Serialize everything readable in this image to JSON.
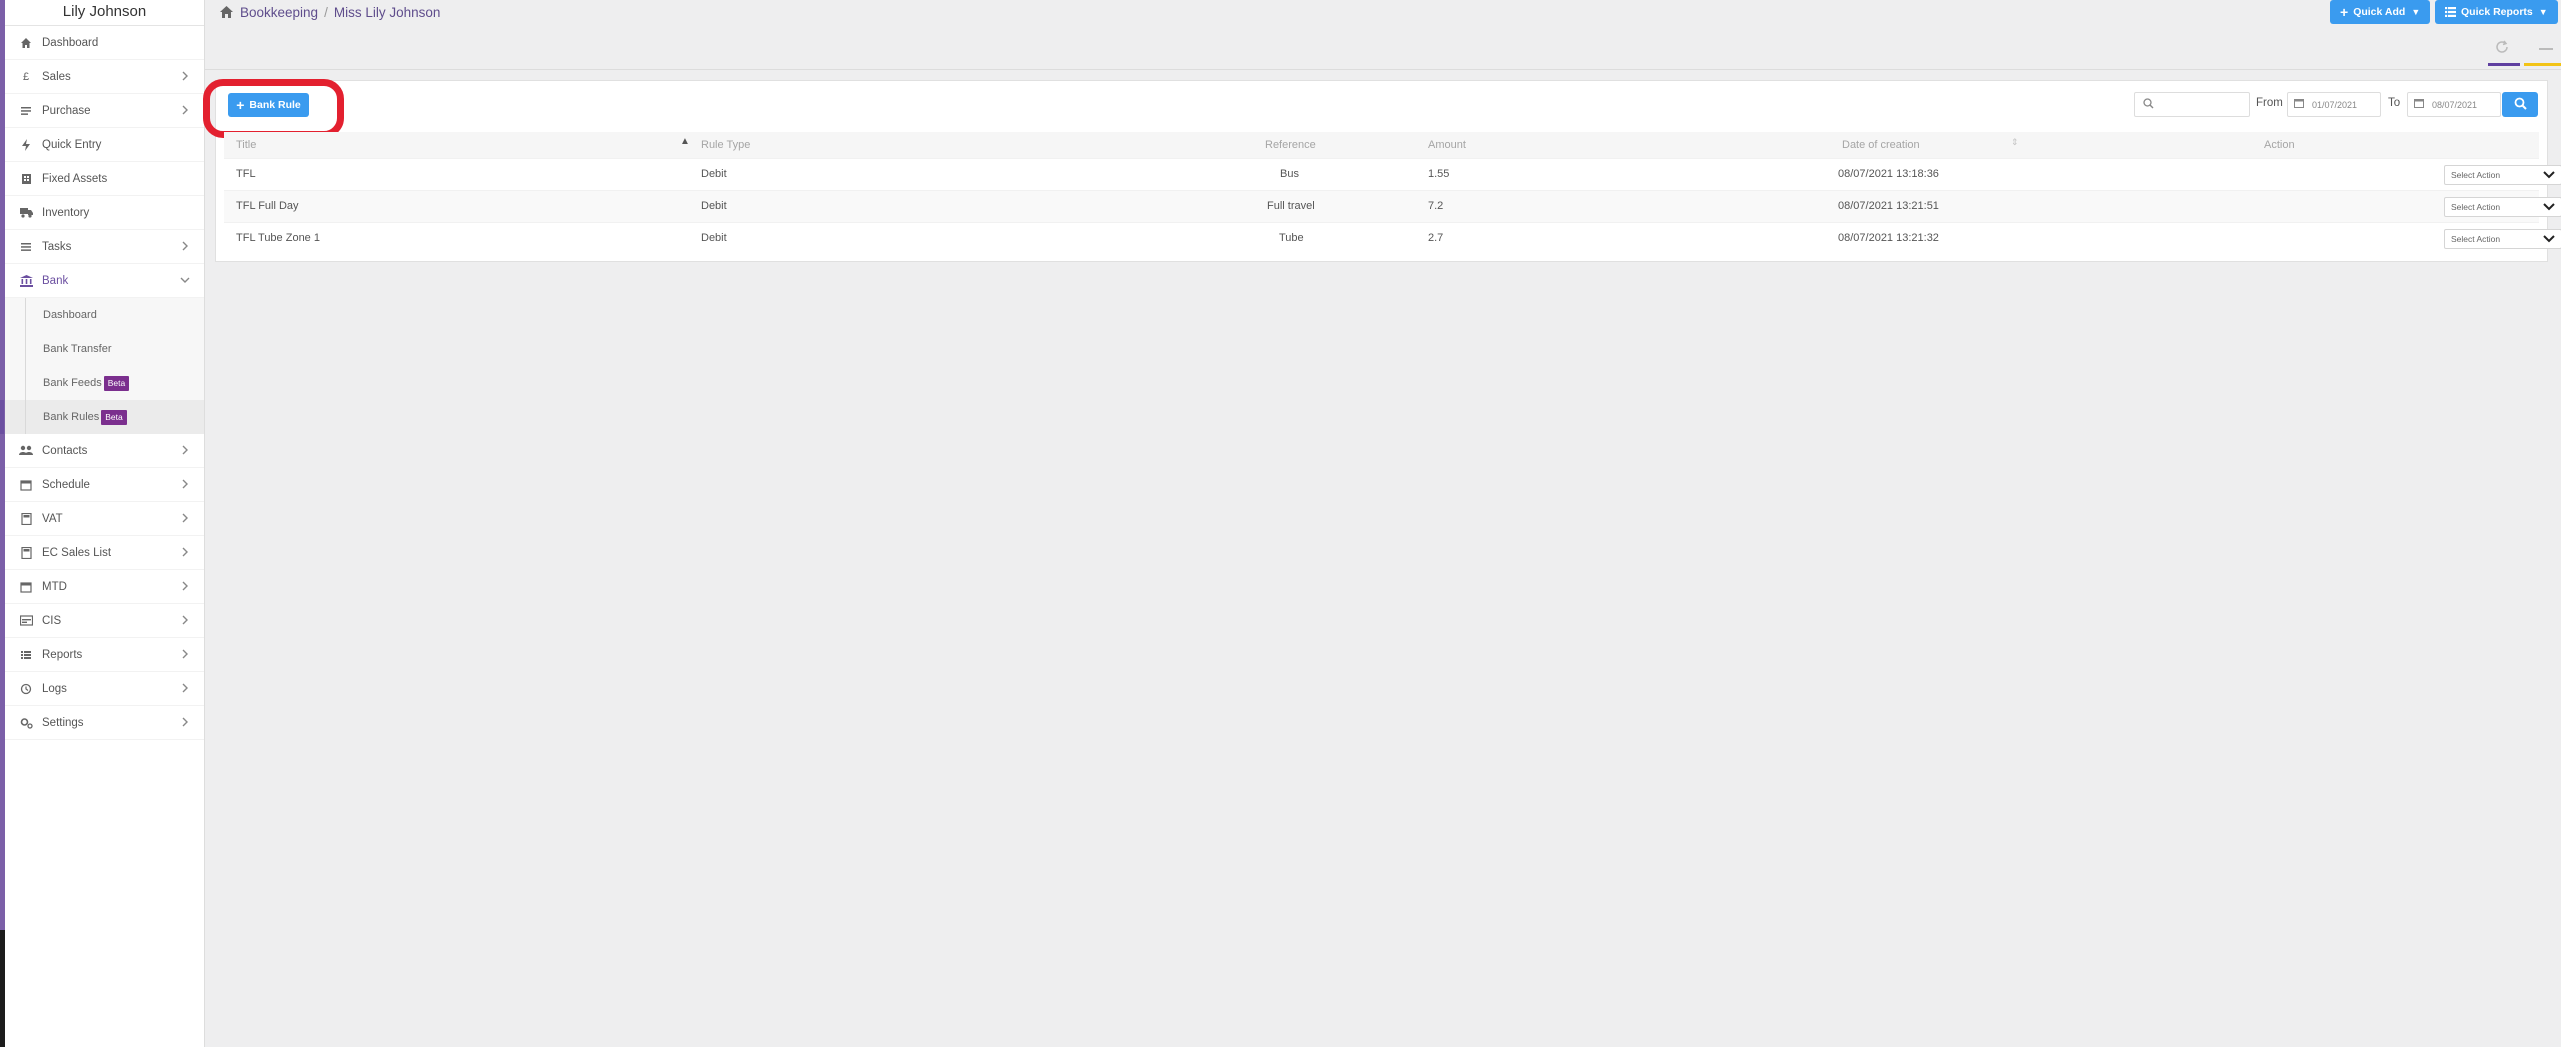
{
  "user": {
    "name": "Lily Johnson"
  },
  "sidebar": {
    "items": [
      {
        "label": "Dashboard",
        "icon": "home-icon"
      },
      {
        "label": "Sales",
        "icon": "pound-icon"
      },
      {
        "label": "Purchase",
        "icon": "list-icon"
      },
      {
        "label": "Quick Entry",
        "icon": "bolt-icon"
      },
      {
        "label": "Fixed Assets",
        "icon": "building-icon"
      },
      {
        "label": "Inventory",
        "icon": "truck-icon"
      },
      {
        "label": "Tasks",
        "icon": "tasks-icon"
      },
      {
        "label": "Bank",
        "icon": "bank-icon"
      }
    ],
    "bank_sub": [
      {
        "label": "Dashboard"
      },
      {
        "label": "Bank Transfer"
      },
      {
        "label": "Bank Feeds",
        "badge": "Beta"
      },
      {
        "label": "Bank Rules",
        "badge": "Beta"
      }
    ],
    "items_after": [
      {
        "label": "Contacts",
        "icon": "users-icon"
      },
      {
        "label": "Schedule",
        "icon": "calendar-icon"
      },
      {
        "label": "VAT",
        "icon": "calculator-icon"
      },
      {
        "label": "EC Sales List",
        "icon": "calculator-icon"
      },
      {
        "label": "MTD",
        "icon": "calendar-icon"
      },
      {
        "label": "CIS",
        "icon": "card-icon"
      },
      {
        "label": "Reports",
        "icon": "report-list-icon"
      },
      {
        "label": "Logs",
        "icon": "history-icon"
      },
      {
        "label": "Settings",
        "icon": "cogs-icon"
      }
    ]
  },
  "breadcrumb": {
    "root": "Bookkeeping",
    "separator": "/",
    "current": "Miss Lily Johnson"
  },
  "header": {
    "quick_add": "Quick Add",
    "quick_reports": "Quick Reports"
  },
  "toolbar": {
    "bank_rule_button": "Bank Rule",
    "search_placeholder": "",
    "from_label": "From",
    "from_date": "01/07/2021",
    "to_label": "To",
    "to_date": "08/07/2021"
  },
  "table": {
    "columns": [
      "Title",
      "Rule Type",
      "Reference",
      "Amount",
      "Date of creation",
      "Action"
    ],
    "rows": [
      {
        "title": "TFL",
        "rule_type": "Debit",
        "reference": "Bus",
        "amount": "1.55",
        "date": "08/07/2021 13:18:36",
        "action": "Select Action"
      },
      {
        "title": "TFL Full Day",
        "rule_type": "Debit",
        "reference": "Full travel",
        "amount": "7.2",
        "date": "08/07/2021 13:21:51",
        "action": "Select Action"
      },
      {
        "title": "TFL Tube Zone 1",
        "rule_type": "Debit",
        "reference": "Tube",
        "amount": "2.7",
        "date": "08/07/2021 13:21:32",
        "action": "Select Action"
      }
    ]
  },
  "colors": {
    "accent": "#3a9bef",
    "brand": "#6b4fa0",
    "highlight": "#e3202f",
    "badge": "#7b2f8e"
  }
}
